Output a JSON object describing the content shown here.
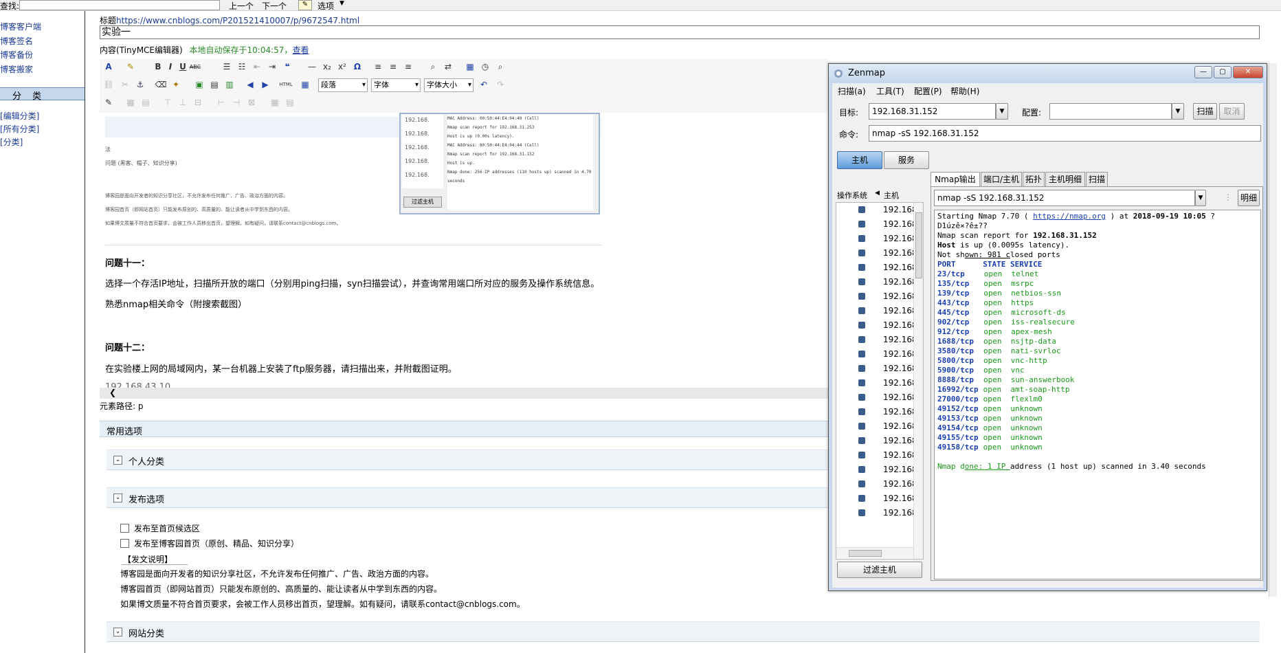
{
  "findbar": {
    "label": "查找:",
    "prev": "上一个",
    "next": "下一个",
    "options": "选项"
  },
  "sidebar": {
    "links": [
      "博客客户端",
      "博客签名",
      "博客备份",
      "博客搬家"
    ],
    "category_header": "分 类",
    "cat_links": [
      "[编辑分类]",
      "[所有分类]",
      "[分类]"
    ]
  },
  "editor": {
    "title_label": "标题",
    "title_url": "https://www.cnblogs.com/P201521410007/p/9672547.html",
    "title_value": "实验一",
    "content_label": "内容",
    "content_editor": "(TinyMCE编辑器)",
    "autosave": "本地自动保存于10:04:57，",
    "view_link": "查看",
    "toolbar": {
      "para_select": "段落",
      "font_select": "字体",
      "size_select": "字体大小"
    },
    "embedded_screenshot": {
      "hosts": [
        "192.168.",
        "192.168.",
        "192.168.",
        "192.168.",
        "192.168."
      ],
      "btn": "过滤主机",
      "out_lines": [
        "MAC Address: 00:50:44:E4:04:40 (Cell)",
        "Nmap scan report for 192.168.31.253",
        "Host is up (0.00s latency).",
        "MAC Address: 80:50:44:E4:04:44 (Cell)",
        "Nmap scan report for 192.168.31.152",
        "Host is up.",
        "Nmap done: 256 IP addresses (110 hosts up) scanned in 4.70",
        "seconds"
      ]
    },
    "faded_lines": [
      "法",
      "问题 (黑客、帽子、知识分享)",
      "博客园是面向开发者的知识分享社区，不允许发布任何推广、广告、政治方面的内容。",
      "博客园首页（即网站首页）只能发布原创的、高质量的、能让读者从中学到东西的内容。",
      "如果博文质量不符合首页要求，会被工作人员移出首页，望理解。如有疑问，请联系contact@cnblogs.com。"
    ],
    "q11_title": "问题十一：",
    "q11_body": "选择一个存活IP地址，扫描所开放的端口（分别用ping扫描，syn扫描尝试），并查询常用端口所对应的服务及操作系统信息。",
    "q11_note": "熟悉nmap相关命令（附搜索截图）",
    "q12_title": "问题十二：",
    "q12_body": "在实验楼上网的局域网内，某一台机器上安装了ftp服务器，请扫描出来，并附截图证明。",
    "q12_cut": "192.168.43.10",
    "element_path": "元素路径: p"
  },
  "options": {
    "header": "常用选项",
    "personal": "个人分类",
    "publish": "发布选项",
    "cb1": "发布至首页候选区",
    "cb2": "发布至博客园首页（原创、精品、知识分享）",
    "note_title": "【发文说明】",
    "note1": "博客园是面向开发者的知识分享社区，不允许发布任何推广、广告、政治方面的内容。",
    "note2": "博客园首页（即网站首页）只能发布原创的、高质量的、能让读者从中学到东西的内容。",
    "note3": "如果博文质量不符合首页要求，会被工作人员移出首页，望理解。如有疑问，请联系contact@cnblogs.com。",
    "site_cat": "网站分类"
  },
  "zenmap": {
    "title": "Zenmap",
    "menu": [
      "扫描(a)",
      "工具(T)",
      "配置(P)",
      "帮助(H)"
    ],
    "target_label": "目标:",
    "target_value": "192.168.31.152",
    "profile_label": "配置:",
    "scan_btn": "扫描",
    "cancel_btn": "取消",
    "cmd_label": "命令:",
    "cmd_value": "nmap -sS 192.168.31.152",
    "host_btn": "主机",
    "service_btn": "服务",
    "os_col": "操作系统",
    "host_col": "主机",
    "hosts": [
      "192.168.3",
      "192.168.3",
      "192.168.3",
      "192.168.3",
      "192.168.3",
      "192.168.3",
      "192.168.3",
      "192.168.3",
      "192.168.3",
      "192.168.3",
      "192.168.3",
      "192.168.3",
      "192.168.3",
      "192.168.3",
      "192.168.3",
      "192.168.3",
      "192.168.3",
      "192.168.3",
      "192.168.3",
      "192.168.3",
      "192.168.3",
      "192.168.3"
    ],
    "filter_btn": "过滤主机",
    "tabs": [
      "Nmap输出",
      "端口/主机",
      "拓扑",
      "主机明细",
      "扫描"
    ],
    "output_select": "nmap -sS 192.168.31.152",
    "detail_btn": "明细",
    "out": {
      "l1a": "Starting Nmap 7.70 ( ",
      "l1b": "https://nmap.org",
      "l1c": " ) at ",
      "l1d": "2018-09-19 10:05",
      "l1e": " ?",
      "l2": "D1úzê×?ê±??",
      "l3a": "Nmap scan report for ",
      "l3b": "192.168.31.152",
      "l4a": "Host",
      "l4b": " is up (0.0095s latency).",
      "l5a": "Not sh",
      "l5b": "own: 981 c",
      "l5c": "losed ports",
      "hdr": "PORT      STATE SERVICE",
      "ports": [
        {
          "p": "23/tcp",
          "s": "open",
          "v": "telnet"
        },
        {
          "p": "135/tcp",
          "s": "open",
          "v": "msrpc"
        },
        {
          "p": "139/tcp",
          "s": "open",
          "v": "netbios-ssn"
        },
        {
          "p": "443/tcp",
          "s": "open",
          "v": "https"
        },
        {
          "p": "445/tcp",
          "s": "open",
          "v": "microsoft-ds"
        },
        {
          "p": "902/tcp",
          "s": "open",
          "v": "iss-realsecure"
        },
        {
          "p": "912/tcp",
          "s": "open",
          "v": "apex-mesh"
        },
        {
          "p": "1688/tcp",
          "s": "open",
          "v": "nsjtp-data"
        },
        {
          "p": "3580/tcp",
          "s": "open",
          "v": "nati-svrloc"
        },
        {
          "p": "5800/tcp",
          "s": "open",
          "v": "vnc-http"
        },
        {
          "p": "5900/tcp",
          "s": "open",
          "v": "vnc"
        },
        {
          "p": "8888/tcp",
          "s": "open",
          "v": "sun-answerbook"
        },
        {
          "p": "16992/tcp",
          "s": "open",
          "v": "amt-soap-http"
        },
        {
          "p": "27000/tcp",
          "s": "open",
          "v": "flexlm0"
        },
        {
          "p": "49152/tcp",
          "s": "open",
          "v": "unknown"
        },
        {
          "p": "49153/tcp",
          "s": "open",
          "v": "unknown"
        },
        {
          "p": "49154/tcp",
          "s": "open",
          "v": "unknown"
        },
        {
          "p": "49155/tcp",
          "s": "open",
          "v": "unknown"
        },
        {
          "p": "49158/tcp",
          "s": "open",
          "v": "unknown"
        }
      ],
      "done_a": "Nmap d",
      "done_b": "one: 1 IP ",
      "done_c": "address (1 host up) scanned in 3.40 seconds"
    }
  }
}
